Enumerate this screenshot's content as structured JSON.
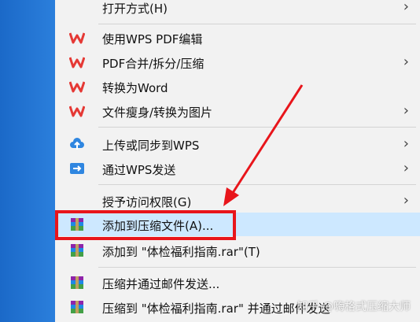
{
  "menu": {
    "items": [
      {
        "label": "打开方式(H)",
        "icon": "none",
        "submenu": true
      },
      {
        "label": "使用WPS PDF编辑",
        "icon": "wps-icon",
        "submenu": false
      },
      {
        "label": "PDF合并/拆分/压缩",
        "icon": "wps-icon",
        "submenu": true
      },
      {
        "label": "转换为Word",
        "icon": "wps-icon",
        "submenu": false
      },
      {
        "label": "文件瘦身/转换为图片",
        "icon": "wps-icon",
        "submenu": true
      },
      {
        "label": "上传或同步到WPS",
        "icon": "cloud-upload-icon",
        "submenu": true
      },
      {
        "label": "通过WPS发送",
        "icon": "send-icon",
        "submenu": true
      },
      {
        "label": "授予访问权限(G)",
        "icon": "none",
        "submenu": true
      },
      {
        "label": "添加到压缩文件(A)...",
        "icon": "winrar-icon",
        "submenu": false,
        "highlighted": true
      },
      {
        "label": "添加到 \"体检福利指南.rar\"(T)",
        "icon": "winrar-icon",
        "submenu": false
      },
      {
        "label": "压缩并通过邮件发送...",
        "icon": "winrar-icon",
        "submenu": false
      },
      {
        "label": "压缩到 \"体检福利指南.rar\" 并通过邮件发送",
        "icon": "winrar-icon",
        "submenu": false
      }
    ],
    "chevron": "›"
  },
  "annotation": {
    "arrow_color": "#e8151b",
    "box_color": "#e8151b"
  },
  "watermark": "知乎 @嗨格式压缩大师",
  "colors": {
    "menu_bg": "#f2f2f2",
    "highlight_bg": "#cde8ff",
    "left_strip": "#2473d2"
  }
}
